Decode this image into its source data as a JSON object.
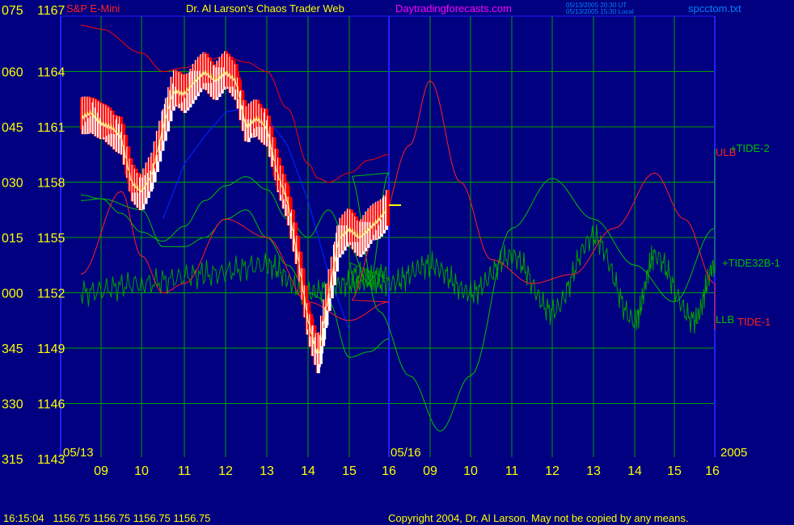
{
  "header": {
    "instrument": "S&P E-Mini",
    "title": "Dr. Al Larson's Chaos Trader Web",
    "website": "Daytradingforecasts.com",
    "timestamp_ut": "05/13/2005 20:30 UT",
    "timestamp_local": "05/13/2005 15:30 Local",
    "filename": "spcctom.txt"
  },
  "footer": {
    "quote": "16:15:04   1156.75 1156.75 1156.75 1156.75",
    "copyright": "Copyright 2004, Dr. Al Larson. May not be copied by any means."
  },
  "colors": {
    "background": "#000080",
    "grid": "#00a000",
    "axis_text": "#ffff00",
    "price_up": "#ffffff",
    "price_down": "#ff0000",
    "ulb_llb": "#ff0000",
    "tide2": "#00c000",
    "tide1": "#ff2020",
    "tide32b": "#00a000",
    "blue_line": "#0020ff",
    "divider": "#2020ff"
  },
  "chart_data": {
    "type": "line",
    "title": "S&P E-Mini",
    "y_left_ticks": [
      {
        "angle": "075",
        "price": "1167"
      },
      {
        "angle": "060",
        "price": "1164"
      },
      {
        "angle": "045",
        "price": "1161"
      },
      {
        "angle": "030",
        "price": "1158"
      },
      {
        "angle": "015",
        "price": "1155"
      },
      {
        "angle": "000",
        "price": "1152"
      },
      {
        "angle": "345",
        "price": "1149"
      },
      {
        "angle": "330",
        "price": "1146"
      },
      {
        "angle": "315",
        "price": "1143"
      }
    ],
    "ylim": [
      1143,
      1167
    ],
    "x_tick_labels": [
      "09",
      "10",
      "11",
      "12",
      "13",
      "14",
      "15",
      "16",
      "09",
      "10",
      "11",
      "12",
      "13",
      "14",
      "15",
      "16"
    ],
    "date_labels": {
      "day1": "05/13",
      "day2": "05/16",
      "year": "2005"
    },
    "series_labels": [
      "ULB",
      "+TIDE-2",
      "+TIDE32B-1",
      "LLB",
      "TIDE-1"
    ],
    "series": [
      {
        "name": "Price (5/13)",
        "x": [
          8.5,
          8.75,
          9,
          9.25,
          9.5,
          9.75,
          10,
          10.25,
          10.5,
          10.75,
          11,
          11.25,
          11.5,
          11.75,
          12,
          12.25,
          12.5,
          12.75,
          13,
          13.25,
          13.5,
          13.75,
          14,
          14.25,
          14.5,
          14.75,
          15,
          15.25,
          15.5,
          15.75,
          16
        ],
        "values": [
          1161.5,
          1161.8,
          1161.2,
          1161,
          1160.5,
          1158,
          1157.5,
          1158.5,
          1161,
          1163,
          1162.8,
          1163.5,
          1164,
          1163.5,
          1164,
          1163.5,
          1161,
          1161.5,
          1161,
          1158.5,
          1157,
          1154,
          1150.5,
          1148.5,
          1152,
          1155,
          1155.5,
          1155,
          1155.5,
          1156,
          1156.75
        ]
      },
      {
        "name": "ULB",
        "x": [
          8.5,
          9,
          10,
          10.5,
          11,
          11.5,
          12,
          12.5,
          13,
          13.5,
          14,
          14.25,
          14.5,
          15,
          15.5,
          16
        ],
        "values": [
          1166.5,
          1166.3,
          1165,
          1164,
          1164.2,
          1164.6,
          1164.8,
          1164.5,
          1164,
          1162,
          1159,
          1158.2,
          1158,
          1158.5,
          1159.2,
          1159.5
        ]
      },
      {
        "name": "LLB",
        "x": [
          8.5,
          9,
          10,
          10.5,
          11,
          11.5,
          12,
          12.5,
          13,
          13.5,
          14,
          14.5,
          15,
          15.5,
          16
        ],
        "values": [
          1157,
          1157.1,
          1156.5,
          1154.5,
          1154.5,
          1155,
          1156,
          1156.5,
          1155,
          1153.5,
          1152,
          1151.5,
          1148.5,
          1148.8,
          1149.5
        ]
      },
      {
        "name": "+TIDE-2",
        "x": [
          8.5,
          9,
          9.5,
          10,
          10.5,
          11,
          11.5,
          12,
          12.5,
          13,
          13.5,
          14,
          14.5,
          15,
          15.5,
          16,
          16.75,
          17.5,
          18.25,
          19,
          20,
          21,
          22,
          23,
          24,
          25,
          25.5
        ],
        "values": [
          1157.3,
          1157.1,
          1156.3,
          1155.3,
          1154.8,
          1155.6,
          1157,
          1157.8,
          1158.3,
          1157.6,
          1156,
          1155,
          1156.5,
          1154.5,
          1152.5,
          1158.5,
          1151,
          1147.5,
          1144.5,
          1147.5,
          1155.5,
          1158.2,
          1156,
          1153.5,
          1151.5,
          1155.5,
          1159.8
        ]
      },
      {
        "name": "TIDE-1",
        "x": [
          8.5,
          9.5,
          10,
          10.5,
          11,
          12,
          13,
          14,
          15,
          16,
          16.75,
          17.5,
          18,
          18.75,
          19.5,
          20.5,
          21.5,
          22.5,
          23.5,
          24.25,
          25,
          25.5
        ],
        "values": [
          1153,
          1157.5,
          1154,
          1152,
          1152.5,
          1156,
          1155,
          1151.5,
          1150.5,
          1151.5,
          1155.5,
          1160,
          1163.5,
          1158,
          1153.8,
          1152.5,
          1153,
          1155.5,
          1158.5,
          1156,
          1152.5,
          1150
        ]
      },
      {
        "name": "+TIDE32B-1",
        "x": [
          8.5,
          10,
          11.5,
          13,
          14,
          15,
          16,
          17,
          18,
          19,
          20,
          21,
          22,
          23,
          23.5,
          24.5,
          25,
          25.5
        ],
        "values": [
          1152,
          1152.5,
          1153,
          1153.5,
          1152,
          1152.5,
          1153,
          1152.5,
          1153.5,
          1152,
          1154,
          1151,
          1155,
          1150.5,
          1154,
          1150.5,
          1153.5,
          1155
        ]
      }
    ]
  }
}
